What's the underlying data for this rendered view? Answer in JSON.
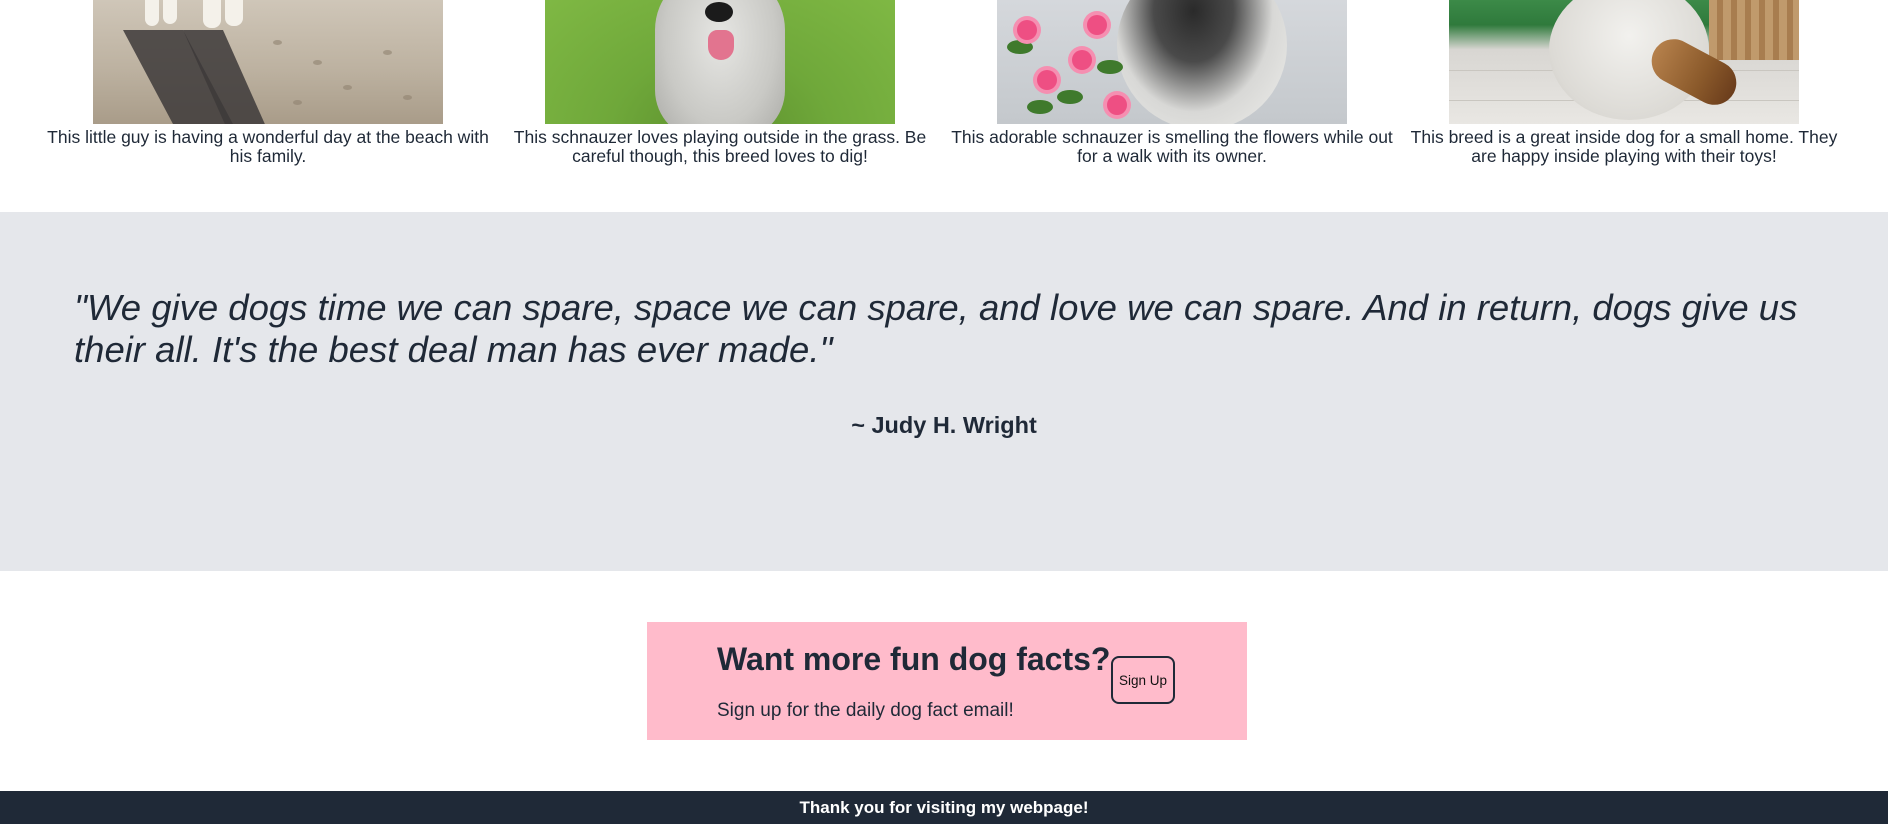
{
  "gallery": {
    "items": [
      {
        "image": "beach-dog-photo",
        "caption": "This little guy is having a wonderful day at the beach with his family."
      },
      {
        "image": "grass-schnauzer-photo",
        "caption": "This schnauzer loves playing outside in the grass. Be careful though, this breed loves to dig!"
      },
      {
        "image": "flowers-schnauzer-photo",
        "caption": "This adorable schnauzer is smelling the flowers while out for a walk with its owner."
      },
      {
        "image": "indoor-dog-toys-photo",
        "caption": "This breed is a great inside dog for a small home. They are happy inside playing with their toys!"
      }
    ]
  },
  "quote": {
    "text": "\"We give dogs time we can spare, space we can spare, and love we can spare. And in return, dogs give us their all. It's the best deal man has ever made.\"",
    "author": "~ Judy H. Wright"
  },
  "signup": {
    "title": "Want more fun dog facts?",
    "text": "Sign up for the daily dog fact email!",
    "button_label": "Sign Up"
  },
  "footer": {
    "text": "Thank you for visiting my webpage!"
  },
  "colors": {
    "quote_band_bg": "#e5e7eb",
    "signup_bg": "#ffbbcb",
    "footer_bg": "#1f2937",
    "text": "#1f2937"
  }
}
